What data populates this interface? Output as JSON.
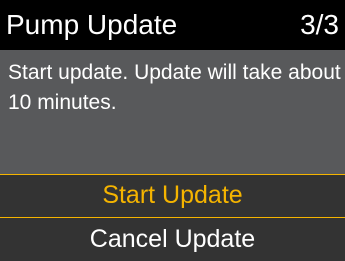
{
  "header": {
    "title": "Pump Update",
    "step": "3/3"
  },
  "message": "Start update. Update will take about 10 minutes.",
  "menu": {
    "options": [
      {
        "label": "Start Update",
        "selected": true
      },
      {
        "label": "Cancel Update",
        "selected": false
      }
    ]
  },
  "colors": {
    "header_bg": "#000000",
    "body_bg": "#58595b",
    "menu_bg": "#333333",
    "accent": "#f5b400",
    "text": "#ffffff"
  }
}
